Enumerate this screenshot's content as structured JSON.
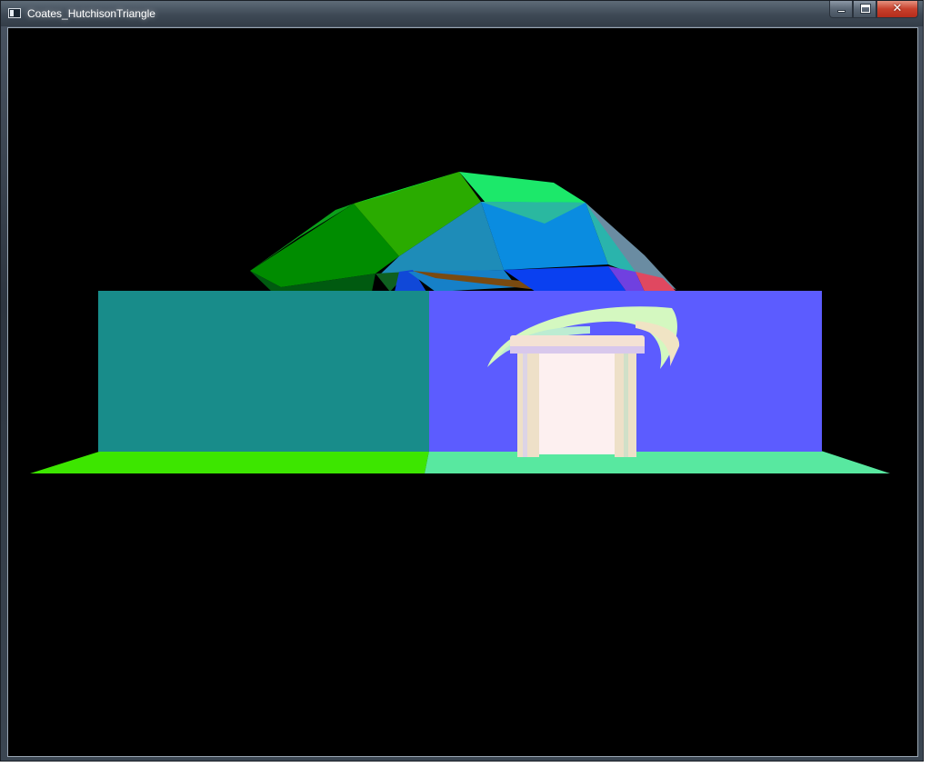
{
  "window": {
    "title": "Coates_HutchisonTriangle",
    "app_icon": "console-window-icon",
    "controls": {
      "minimize_icon": "minimize-icon",
      "maximize_icon": "maximize-icon",
      "close_icon": "close-icon",
      "close_glyph": "✕"
    }
  },
  "viewport": {
    "background": "#000000",
    "scene": {
      "dome_colors": [
        "#00e63c",
        "#29a800",
        "#008c00",
        "#1e8cb4",
        "#0a8cdc",
        "#2ab4a8",
        "#6a8ca0"
      ],
      "wall_left_color": "#188c8a",
      "wall_right_color": "#5c5cff",
      "ground_left_color": "#3de600",
      "ground_right_color": "#58e8a0",
      "door_color": "#fdf0f0",
      "pillar_color": "#eee0c8",
      "arch_color": "#d4f8c0"
    }
  }
}
